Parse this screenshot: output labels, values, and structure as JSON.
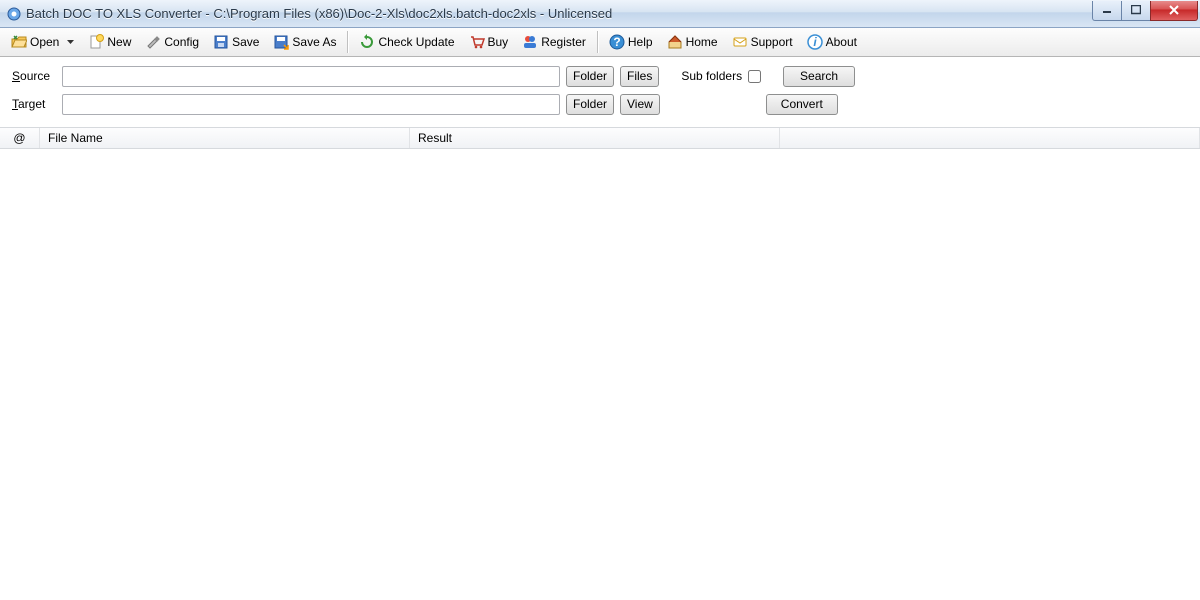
{
  "title": "Batch DOC TO XLS Converter - C:\\Program Files (x86)\\Doc-2-Xls\\doc2xls.batch-doc2xls - Unlicensed",
  "toolbar": {
    "open": "Open",
    "new": "New",
    "config": "Config",
    "save": "Save",
    "save_as": "Save As",
    "check_update": "Check Update",
    "buy": "Buy",
    "register": "Register",
    "help": "Help",
    "home": "Home",
    "support": "Support",
    "about": "About"
  },
  "form": {
    "source_label_prefix": "S",
    "source_label_rest": "ource",
    "target_label_prefix": "T",
    "target_label_rest": "arget",
    "source_value": "",
    "target_value": "",
    "folder_btn": "Folder",
    "files_btn": "Files",
    "view_btn": "View",
    "sub_folders_label": "Sub folders",
    "search_btn": "Search",
    "convert_btn": "Convert"
  },
  "table": {
    "col_at": "@",
    "col_file": "File Name",
    "col_result": "Result",
    "rows": []
  }
}
